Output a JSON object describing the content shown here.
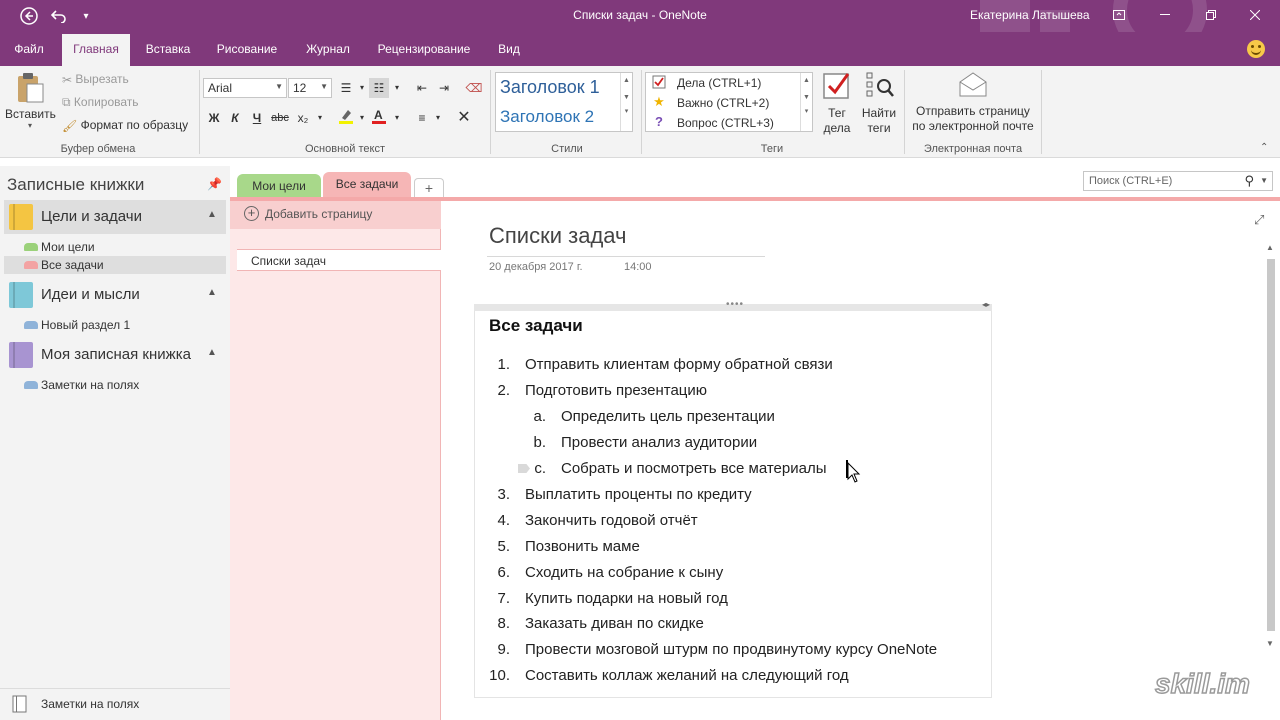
{
  "window": {
    "title": "Списки задач  -  OneNote",
    "user": "Екатерина Латышева",
    "back_icon": "back-arrow-icon",
    "undo_icon": "undo-icon",
    "qat_icon": "customize-qat-icon",
    "help": "?",
    "ribbon_display": "❐",
    "minimize": "—",
    "restore": "❐",
    "close": "✕"
  },
  "ribbon_tabs": [
    "Файл",
    "Главная",
    "Вставка",
    "Рисование",
    "Журнал",
    "Рецензирование",
    "Вид"
  ],
  "ribbon": {
    "clipboard": {
      "paste": "Вставить",
      "cut": "Вырезать",
      "copy": "Копировать",
      "format_painter": "Формат по образцу",
      "label": "Буфер обмена"
    },
    "basic_text": {
      "font": "Arial",
      "size": "12",
      "bold": "Ж",
      "italic": "К",
      "underline": "Ч",
      "strike": "abc",
      "subscript": "x₂",
      "label": "Основной текст"
    },
    "styles": {
      "heading1": "Заголовок 1",
      "heading2": "Заголовок 2",
      "label": "Стили"
    },
    "tags": {
      "items": [
        {
          "label": "Дела (CTRL+1)",
          "icon": "checkbox-icon"
        },
        {
          "label": "Важно (CTRL+2)",
          "icon": "star-icon"
        },
        {
          "label": "Вопрос (CTRL+3)",
          "icon": "question-icon"
        }
      ],
      "todo_tag": "Тег дела",
      "find_tags": "Найти теги",
      "label": "Теги"
    },
    "email": {
      "send": "Отправить страницу по электронной почте",
      "send_line1": "Отправить страницу",
      "send_line2": "по электронной почте",
      "label": "Электронная почта"
    }
  },
  "notebooks_pane": {
    "header": "Записные книжки",
    "notebooks": [
      {
        "name": "Цели и задачи",
        "color": "#f4c542",
        "sections": [
          {
            "name": "Мои цели",
            "color": "#9bd17a"
          },
          {
            "name": "Все задачи",
            "color": "#f3a3a3"
          }
        ]
      },
      {
        "name": "Идеи и мысли",
        "color": "#7ec8d8",
        "sections": [
          {
            "name": "Новый раздел 1",
            "color": "#8fb3d9"
          }
        ]
      },
      {
        "name": "Моя записная книжка",
        "color": "#a894d1",
        "sections": [
          {
            "name": "Заметки на полях",
            "color": "#8fb3d9"
          }
        ]
      }
    ],
    "footer": "Заметки на полях"
  },
  "section_tabs": [
    {
      "name": "Мои цели",
      "color": "#a8d88a"
    },
    {
      "name": "Все задачи",
      "color": "#f6b6b6"
    }
  ],
  "add_tab": "+",
  "search": {
    "placeholder": "Поиск (CTRL+E)"
  },
  "page_list": {
    "add_page": "Добавить страницу",
    "pages": [
      "Списки задач"
    ]
  },
  "page": {
    "title": "Списки задач",
    "date": "20 декабря 2017 г.",
    "time": "14:00",
    "heading": "Все задачи",
    "items": [
      {
        "num": "1.",
        "text": "Отправить клиентам форму обратной  связи"
      },
      {
        "num": "2.",
        "text": "Подготовить презентацию",
        "sub": [
          {
            "num": "a.",
            "text": "Определить цель презентации"
          },
          {
            "num": "b.",
            "text": "Провести анализ аудитории"
          },
          {
            "num": "c.",
            "text": "Собрать и посмотреть все материалы"
          }
        ]
      },
      {
        "num": "3.",
        "text": "Выплатить проценты по кредиту"
      },
      {
        "num": "4.",
        "text": "Закончить годовой отчёт"
      },
      {
        "num": "5.",
        "text": "Позвонить маме"
      },
      {
        "num": "6.",
        "text": "Сходить на собрание к сыну"
      },
      {
        "num": "7.",
        "text": "Купить подарки на новый год"
      },
      {
        "num": "8.",
        "text": "Заказать диван по скидке"
      },
      {
        "num": "9.",
        "text": "Провести мозговой штурм по продвинутому курсу OneNote"
      },
      {
        "num": "10.",
        "text": "Составить коллаж желаний на следующий год"
      }
    ]
  },
  "watermark": "skill.im",
  "colors": {
    "accent": "#80397b",
    "section_pink": "#f4a9a9"
  }
}
